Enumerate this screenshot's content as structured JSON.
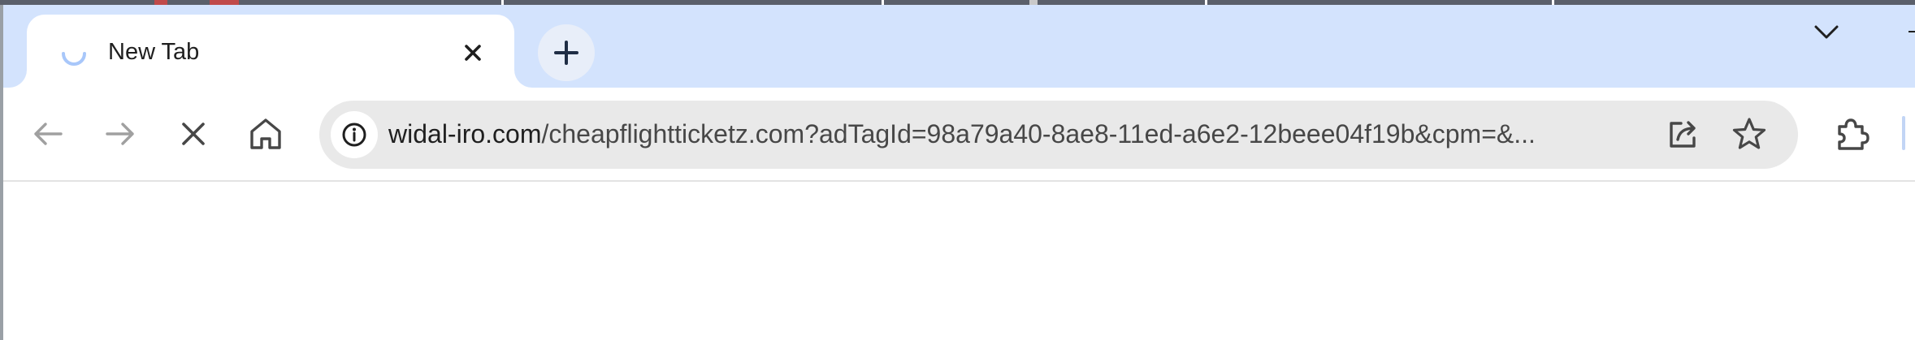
{
  "colors": {
    "tabstrip_bg": "#d3e3fd",
    "omnibox_bg": "#e9e9e9",
    "text_primary": "#1f1f1f",
    "text_secondary": "#474747",
    "spinner": "#a8c7fa"
  },
  "tab": {
    "title": "New Tab",
    "loading_icon": "loading-spinner-icon",
    "close_icon": "close-icon"
  },
  "tabstrip": {
    "new_tab_icon": "plus-icon",
    "tab_search_icon": "chevron-down-icon"
  },
  "toolbar": {
    "back_icon": "arrow-left-icon",
    "forward_icon": "arrow-right-icon",
    "stop_icon": "close-icon",
    "home_icon": "home-icon",
    "extensions_icon": "puzzle-icon"
  },
  "omnibox": {
    "site_info_icon": "info-icon",
    "url_host": "widal-iro.com",
    "url_rest": "/cheapflightticketz.com?adTagId=98a79a40-8ae8-11ed-a6e2-12beee04f19b&cpm=&...",
    "share_icon": "share-icon",
    "bookmark_icon": "star-icon"
  }
}
